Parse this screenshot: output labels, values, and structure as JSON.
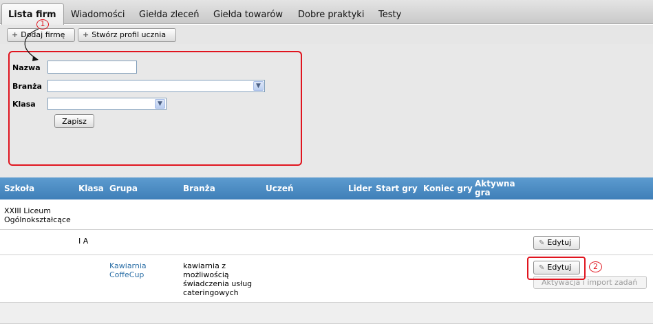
{
  "tabs": [
    "Lista firm",
    "Wiadomości",
    "Giełda zleceń",
    "Giełda towarów",
    "Dobre praktyki",
    "Testy"
  ],
  "toolbar": {
    "add_company": "Dodaj firmę",
    "create_profile": "Stwórz profil ucznia"
  },
  "form": {
    "name_label": "Nazwa",
    "name_value": "",
    "industry_label": "Branża",
    "industry_value": "",
    "class_label": "Klasa",
    "class_value": "",
    "save_label": "Zapisz"
  },
  "markers": {
    "one": "1",
    "two": "2"
  },
  "table": {
    "headers": {
      "school": "Szkoła",
      "class": "Klasa",
      "group": "Grupa",
      "industry": "Branża",
      "student": "Uczeń",
      "leader": "Lider",
      "start": "Start gry",
      "end": "Koniec gry",
      "active_1": "Aktywna",
      "active_2": "gra"
    },
    "rows": [
      {
        "school_1": "XXIII Liceum",
        "school_2": "Ogólnokształcące"
      },
      {
        "class": "I A",
        "edit": "Edytuj"
      },
      {
        "group_1": "Kawiarnia",
        "group_2": "CoffeCup",
        "industry_1": "kawiarnia z",
        "industry_2": "możliwością",
        "industry_3": "świadczenia usług",
        "industry_4": "cateringowych",
        "edit": "Edytuj",
        "activate": "Aktywacja i import zadań"
      }
    ]
  },
  "colors": {
    "annotation": "#e0141e",
    "header_bg": "#4a8cc4",
    "link": "#2a6ea6"
  },
  "icons": [
    "plus-icon",
    "pencil-icon",
    "dropdown-arrow-icon"
  ]
}
